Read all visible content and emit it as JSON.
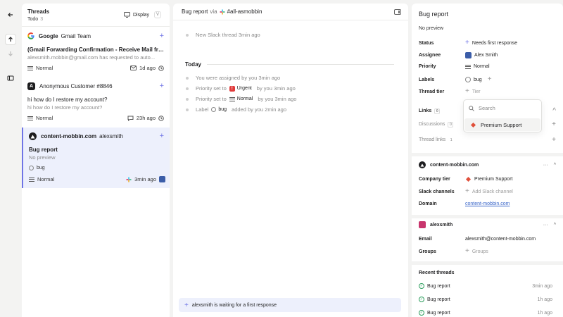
{
  "threads_panel": {
    "title": "Threads",
    "filter": "Todo",
    "count": "3",
    "display_label": "Display",
    "display_kbd": "V"
  },
  "threads": [
    {
      "sender": "Google",
      "sender2": "Gmail Team",
      "subject": "(Gmail Forwarding Confirmation - Receive Mail from ...",
      "preview": "alexsmith.mobbin@gmail.com has requested to auto...",
      "priority": "Normal",
      "time": "1d ago"
    },
    {
      "sender": "Anonymous Customer #8846",
      "avatar_letter": "A",
      "subject": "hi how do I restore my account?",
      "preview": "hi how do I restore my account?",
      "priority": "Normal",
      "time": "23h ago"
    },
    {
      "sender": "content-mobbin.com",
      "sender2": "alexsmith",
      "subject": "Bug report",
      "preview": "No preview",
      "label": "bug",
      "priority": "Normal",
      "time": "3min ago"
    }
  ],
  "main": {
    "title": "Bug report",
    "via": "via",
    "channel": "#all-asmobbin",
    "event_slack": "New Slack thread 3min ago",
    "today": "Today",
    "event_assigned": "You were assigned by you 3min ago",
    "event_priority1_pre": "Priority set to",
    "event_priority1_value": "Urgent",
    "event_priority1_post": "by you 3min ago",
    "urgent_mark": "!",
    "event_priority2_pre": "Priority set to",
    "event_priority2_value": "Normal",
    "event_priority2_post": "by you 3min ago",
    "event_label_pre": "Label",
    "event_label_value": "bug",
    "event_label_post": "added by you 2min ago",
    "waiting": "alexsmith is waiting for a first response"
  },
  "side": {
    "title": "Bug report",
    "no_preview": "No preview",
    "status_k": "Status",
    "status_v": "Needs first response",
    "assignee_k": "Assignee",
    "assignee_v": "Alex Smith",
    "priority_k": "Priority",
    "priority_v": "Normal",
    "labels_k": "Labels",
    "labels_v": "bug",
    "tier_k": "Thread tier",
    "tier_v": "Tier",
    "links_k": "Links",
    "links_n": "0",
    "discussions_k": "Discussions",
    "discussions_n": "0",
    "thread_links_k": "Thread links",
    "thread_links_n": "1",
    "company_name": "content-mobbin.com",
    "company_tier_k": "Company tier",
    "company_tier_v": "Premium Support",
    "slack_k": "Slack channels",
    "slack_v": "Add Slack channel",
    "domain_k": "Domain",
    "domain_v": "content-mobbin.com",
    "user_name": "alexsmith",
    "email_k": "Email",
    "email_v": "alexsmith@content-mobbin.com",
    "groups_k": "Groups",
    "groups_v": "Groups",
    "recent_title": "Recent threads",
    "recent": [
      {
        "title": "Bug report",
        "time": "3min ago"
      },
      {
        "title": "Bug report",
        "time": "1h ago"
      },
      {
        "title": "Bug report",
        "time": "1h ago"
      }
    ],
    "more": "···"
  },
  "dropdown": {
    "search_placeholder": "Search",
    "option": "Premium Support"
  },
  "colors": {
    "accent": "#6f74e6",
    "selected_bg": "#edf0fc",
    "urgent": "#e03b3b",
    "link": "#3a66c9",
    "success": "#2a9d5b"
  }
}
